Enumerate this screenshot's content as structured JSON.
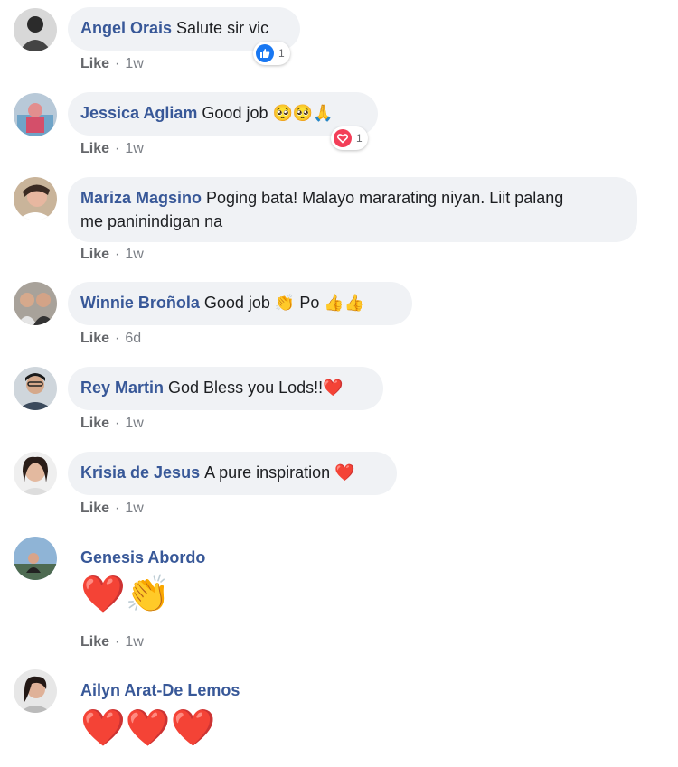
{
  "comments": [
    {
      "name": "Angel Orais",
      "text": "Salute sir vic",
      "like": "Like",
      "sep": "·",
      "time": "1w",
      "reaction": {
        "icon": "like-icon",
        "count": "1"
      }
    },
    {
      "name": "Jessica Agliam",
      "text": "Good job 🥺🥺🙏",
      "like": "Like",
      "sep": "·",
      "time": "1w",
      "reaction": {
        "icon": "heart-icon",
        "count": "1"
      }
    },
    {
      "name": "Mariza Magsino",
      "text": "Poging bata! Malayo mararating niyan. Liit palang",
      "text2": "me paninindigan na",
      "like": "Like",
      "sep": "·",
      "time": "1w"
    },
    {
      "name": "Winnie Broñola",
      "text": "Good job 👏 Po 👍👍",
      "like": "Like",
      "sep": "·",
      "time": "6d"
    },
    {
      "name": "Rey Martin",
      "text": "God Bless you Lods!!❤️",
      "like": "Like",
      "sep": "·",
      "time": "1w"
    },
    {
      "name": "Krisia de Jesus",
      "text": "A pure inspiration ❤️",
      "like": "Like",
      "sep": "·",
      "time": "1w"
    },
    {
      "name": "Genesis Abordo",
      "emoji": "❤️👏",
      "like": "Like",
      "sep": "·",
      "time": "1w"
    },
    {
      "name": "Ailyn Arat-De Lemos",
      "emoji": "❤️❤️❤️"
    }
  ],
  "colors": {
    "name": "#385898",
    "bubble": "#f0f2f5",
    "meta": "#65676b",
    "like_blue": "#1877f2",
    "heart_red": "#f33e58"
  }
}
